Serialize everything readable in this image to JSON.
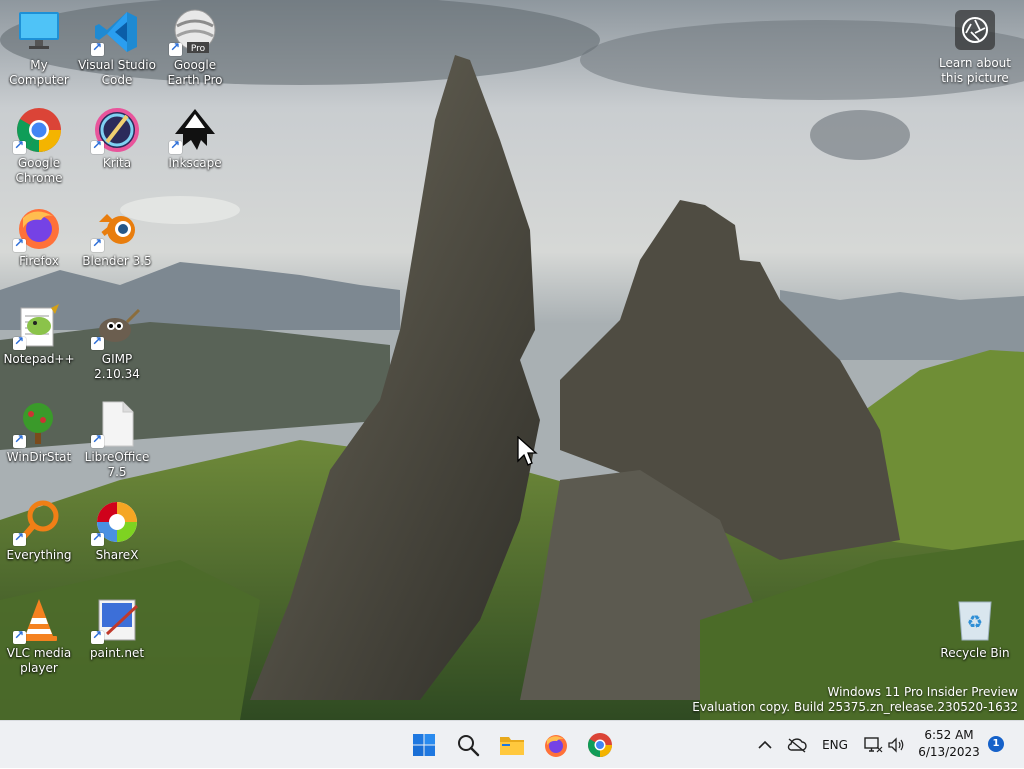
{
  "desktop": {
    "icons": [
      {
        "id": "my-computer",
        "label": "My Computer"
      },
      {
        "id": "vscode",
        "label": "Visual Studio Code"
      },
      {
        "id": "google-earth",
        "label": "Google Earth Pro",
        "badge": "Pro"
      },
      {
        "id": "chrome",
        "label": "Google Chrome"
      },
      {
        "id": "krita",
        "label": "Krita"
      },
      {
        "id": "inkscape",
        "label": "Inkscape"
      },
      {
        "id": "firefox",
        "label": "Firefox"
      },
      {
        "id": "blender",
        "label": "Blender 3.5"
      },
      {
        "id": "notepadpp",
        "label": "Notepad++"
      },
      {
        "id": "gimp",
        "label": "GIMP 2.10.34"
      },
      {
        "id": "windirstat",
        "label": "WinDirStat"
      },
      {
        "id": "libreoffice",
        "label": "LibreOffice 7.5"
      },
      {
        "id": "everything",
        "label": "Everything"
      },
      {
        "id": "sharex",
        "label": "ShareX"
      },
      {
        "id": "vlc",
        "label": "VLC media player"
      },
      {
        "id": "paintnet",
        "label": "paint.net"
      },
      {
        "id": "recycle-bin",
        "label": "Recycle Bin"
      }
    ],
    "learn_about": "Learn about this picture",
    "watermark": {
      "line1": "Windows 11 Pro Insider Preview",
      "line2": "Evaluation copy. Build 25375.zn_release.230520-1632"
    }
  },
  "taskbar": {
    "pinned": [
      {
        "id": "start",
        "icon": "windows-logo-icon"
      },
      {
        "id": "search",
        "icon": "search-icon"
      },
      {
        "id": "file-explorer",
        "icon": "folder-icon"
      },
      {
        "id": "firefox",
        "icon": "firefox-icon"
      },
      {
        "id": "chrome",
        "icon": "chrome-icon"
      }
    ],
    "tray": {
      "language": "ENG",
      "time": "6:52 AM",
      "date": "6/13/2023",
      "notifications": "1"
    }
  },
  "colors": {
    "taskbar_bg": "#eef0f3",
    "accent": "#1561c9"
  }
}
